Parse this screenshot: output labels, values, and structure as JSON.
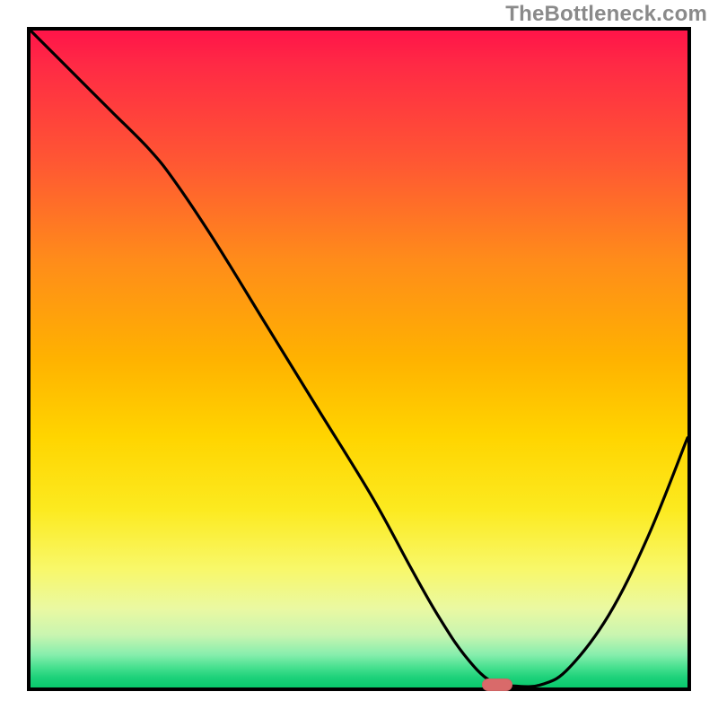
{
  "attribution": "TheBottleneck.com",
  "chart_data": {
    "type": "line",
    "title": "",
    "xlabel": "",
    "ylabel": "",
    "xlim": [
      0,
      100
    ],
    "ylim": [
      0,
      100
    ],
    "grid": false,
    "legend": false,
    "series": [
      {
        "name": "bottleneck-curve",
        "color": "#000000",
        "x": [
          0,
          6,
          12,
          18,
          22,
          28,
          36,
          44,
          52,
          58,
          62,
          66,
          70,
          74,
          78,
          82,
          88,
          94,
          100
        ],
        "values": [
          100,
          94,
          88,
          82,
          77,
          68,
          55,
          42,
          29,
          18,
          11,
          5,
          1,
          0.2,
          0.5,
          3,
          11,
          23,
          38
        ]
      }
    ],
    "marker": {
      "x": 71,
      "y": 0.2,
      "color": "#d96a6a"
    },
    "background_gradient": {
      "stops": [
        {
          "pos": 0,
          "color": "#ff1449"
        },
        {
          "pos": 0.5,
          "color": "#ffb200"
        },
        {
          "pos": 0.82,
          "color": "#f8f86a"
        },
        {
          "pos": 1.0,
          "color": "#09c96c"
        }
      ]
    },
    "axes": {
      "ticks": false,
      "labels": false,
      "border": true
    }
  }
}
